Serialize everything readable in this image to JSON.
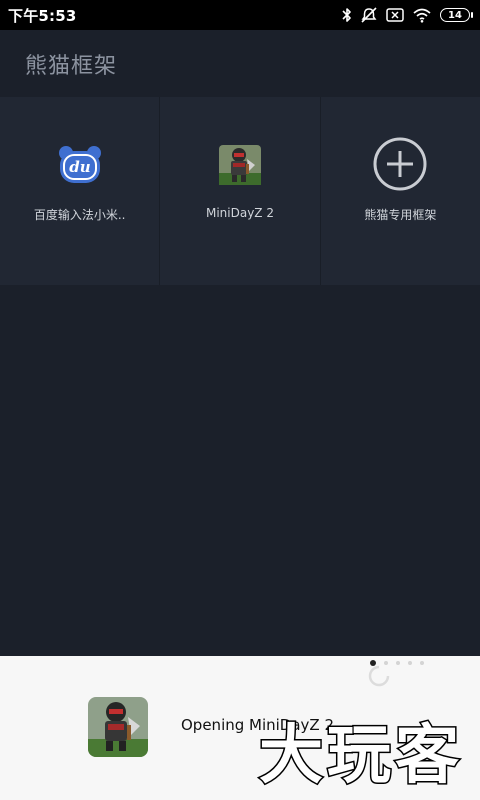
{
  "status_bar": {
    "time": "下午5:53",
    "battery": "14",
    "icons": [
      "bluetooth-icon",
      "silent-icon",
      "sim-icon",
      "wifi-icon",
      "battery-icon"
    ]
  },
  "app": {
    "title": "熊猫框架"
  },
  "grid_items": [
    {
      "label": "百度输入法小米..",
      "icon": "baidu-input-icon",
      "icon_text": "du"
    },
    {
      "label": "MiniDayZ 2",
      "icon": "minidayz-game-icon"
    },
    {
      "label": "熊猫专用框架",
      "icon": "add-circle-icon"
    }
  ],
  "bottom_sheet": {
    "message": "Opening MiniDayZ 2...",
    "icon": "minidayz-game-icon"
  },
  "watermark": {
    "text": "大玩客"
  },
  "colors": {
    "background": "#1b202a",
    "tile": "#212733",
    "title_text": "#8c93a0",
    "sheet": "#f7f7f7",
    "baidu_blue": "#3f6fd0"
  }
}
